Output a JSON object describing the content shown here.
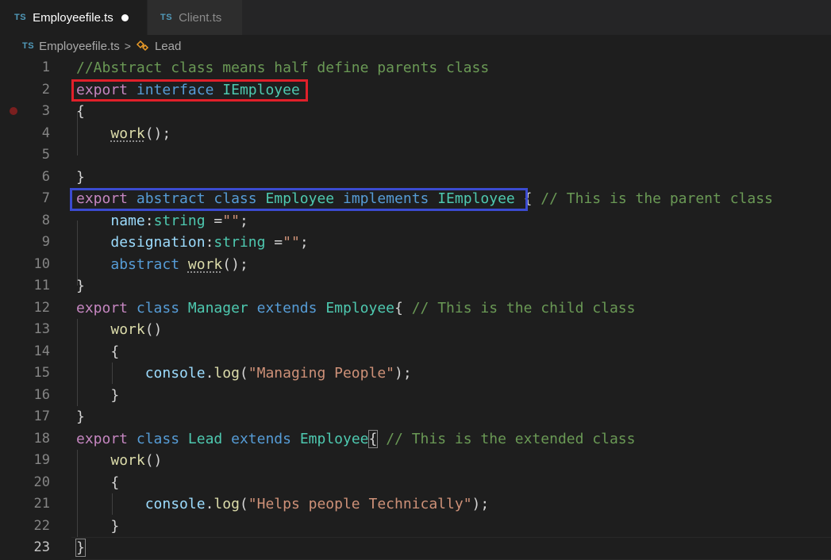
{
  "tabs": [
    {
      "badge": "TS",
      "label": "Employeefile.ts",
      "active": true,
      "dirty": true
    },
    {
      "badge": "TS",
      "label": "Client.ts",
      "active": false,
      "dirty": false
    }
  ],
  "breadcrumb": {
    "badge": "TS",
    "file": "Employeefile.ts",
    "separator": ">",
    "symbol": "Lead"
  },
  "editor": {
    "lines": [
      {
        "n": "1",
        "tokens": [
          [
            "com",
            "//Abstract class means half define parents class"
          ]
        ]
      },
      {
        "n": "2",
        "tokens": [
          [
            "kw-pink",
            "export"
          ],
          [
            "punc",
            " "
          ],
          [
            "kw-blue",
            "interface"
          ],
          [
            "punc",
            " "
          ],
          [
            "type",
            "IEmployee"
          ]
        ]
      },
      {
        "n": "3",
        "tokens": [
          [
            "punc",
            "{"
          ]
        ]
      },
      {
        "n": "4",
        "tokens": [
          [
            "punc",
            "    "
          ],
          [
            "fn squig",
            "work"
          ],
          [
            "punc",
            "();"
          ]
        ]
      },
      {
        "n": "5",
        "tokens": []
      },
      {
        "n": "6",
        "tokens": [
          [
            "punc",
            "}"
          ]
        ]
      },
      {
        "n": "7",
        "tokens": [
          [
            "kw-pink",
            "export"
          ],
          [
            "punc",
            " "
          ],
          [
            "kw-blue",
            "abstract"
          ],
          [
            "punc",
            " "
          ],
          [
            "kw-blue",
            "class"
          ],
          [
            "punc",
            " "
          ],
          [
            "type",
            "Employee"
          ],
          [
            "punc",
            " "
          ],
          [
            "kw-blue",
            "implements"
          ],
          [
            "punc",
            " "
          ],
          [
            "type",
            "IEmployee"
          ],
          [
            "punc",
            " { "
          ],
          [
            "com",
            "// This is the parent class"
          ]
        ]
      },
      {
        "n": "8",
        "tokens": [
          [
            "punc",
            "    "
          ],
          [
            "prop",
            "name"
          ],
          [
            "punc",
            ":"
          ],
          [
            "type",
            "string"
          ],
          [
            "punc",
            " ="
          ],
          [
            "str",
            "\"\""
          ],
          [
            "punc",
            ";"
          ]
        ]
      },
      {
        "n": "9",
        "tokens": [
          [
            "punc",
            "    "
          ],
          [
            "prop",
            "designation"
          ],
          [
            "punc",
            ":"
          ],
          [
            "type",
            "string"
          ],
          [
            "punc",
            " ="
          ],
          [
            "str",
            "\"\""
          ],
          [
            "punc",
            ";"
          ]
        ]
      },
      {
        "n": "10",
        "tokens": [
          [
            "punc",
            "    "
          ],
          [
            "kw-blue",
            "abstract"
          ],
          [
            "punc",
            " "
          ],
          [
            "fn squig",
            "work"
          ],
          [
            "punc",
            "();"
          ]
        ]
      },
      {
        "n": "11",
        "tokens": [
          [
            "punc",
            "}"
          ]
        ]
      },
      {
        "n": "12",
        "tokens": [
          [
            "kw-pink",
            "export"
          ],
          [
            "punc",
            " "
          ],
          [
            "kw-blue",
            "class"
          ],
          [
            "punc",
            " "
          ],
          [
            "type",
            "Manager"
          ],
          [
            "punc",
            " "
          ],
          [
            "kw-blue",
            "extends"
          ],
          [
            "punc",
            " "
          ],
          [
            "type",
            "Employee"
          ],
          [
            "punc",
            "{ "
          ],
          [
            "com",
            "// This is the child class"
          ]
        ]
      },
      {
        "n": "13",
        "tokens": [
          [
            "punc",
            "    "
          ],
          [
            "fn",
            "work"
          ],
          [
            "punc",
            "()"
          ]
        ]
      },
      {
        "n": "14",
        "tokens": [
          [
            "punc",
            "    {"
          ]
        ]
      },
      {
        "n": "15",
        "tokens": [
          [
            "punc",
            "        "
          ],
          [
            "prop",
            "console"
          ],
          [
            "punc",
            "."
          ],
          [
            "fn",
            "log"
          ],
          [
            "punc",
            "("
          ],
          [
            "str",
            "\"Managing People\""
          ],
          [
            "punc",
            ");"
          ]
        ]
      },
      {
        "n": "16",
        "tokens": [
          [
            "punc",
            "    }"
          ]
        ]
      },
      {
        "n": "17",
        "tokens": [
          [
            "punc",
            "}"
          ]
        ]
      },
      {
        "n": "18",
        "tokens": [
          [
            "kw-pink",
            "export"
          ],
          [
            "punc",
            " "
          ],
          [
            "kw-blue",
            "class"
          ],
          [
            "punc",
            " "
          ],
          [
            "type",
            "Lead"
          ],
          [
            "punc",
            " "
          ],
          [
            "kw-blue",
            "extends"
          ],
          [
            "punc",
            " "
          ],
          [
            "type",
            "Employee"
          ],
          [
            "punc brace-box",
            "{"
          ],
          [
            "punc",
            " "
          ],
          [
            "com",
            "// This is the extended class"
          ]
        ]
      },
      {
        "n": "19",
        "tokens": [
          [
            "punc",
            "    "
          ],
          [
            "fn",
            "work"
          ],
          [
            "punc",
            "()"
          ]
        ]
      },
      {
        "n": "20",
        "tokens": [
          [
            "punc",
            "    {"
          ]
        ]
      },
      {
        "n": "21",
        "tokens": [
          [
            "punc",
            "        "
          ],
          [
            "prop",
            "console"
          ],
          [
            "punc",
            "."
          ],
          [
            "fn",
            "log"
          ],
          [
            "punc",
            "("
          ],
          [
            "str",
            "\"Helps people Technically\""
          ],
          [
            "punc",
            ");"
          ]
        ]
      },
      {
        "n": "22",
        "tokens": [
          [
            "punc",
            "    }"
          ]
        ]
      },
      {
        "n": "23",
        "tokens": [
          [
            "punc brace-box",
            "}"
          ]
        ]
      }
    ]
  },
  "colors": {
    "annotation_red": "#e0202a",
    "annotation_blue": "#3b4bd0"
  }
}
